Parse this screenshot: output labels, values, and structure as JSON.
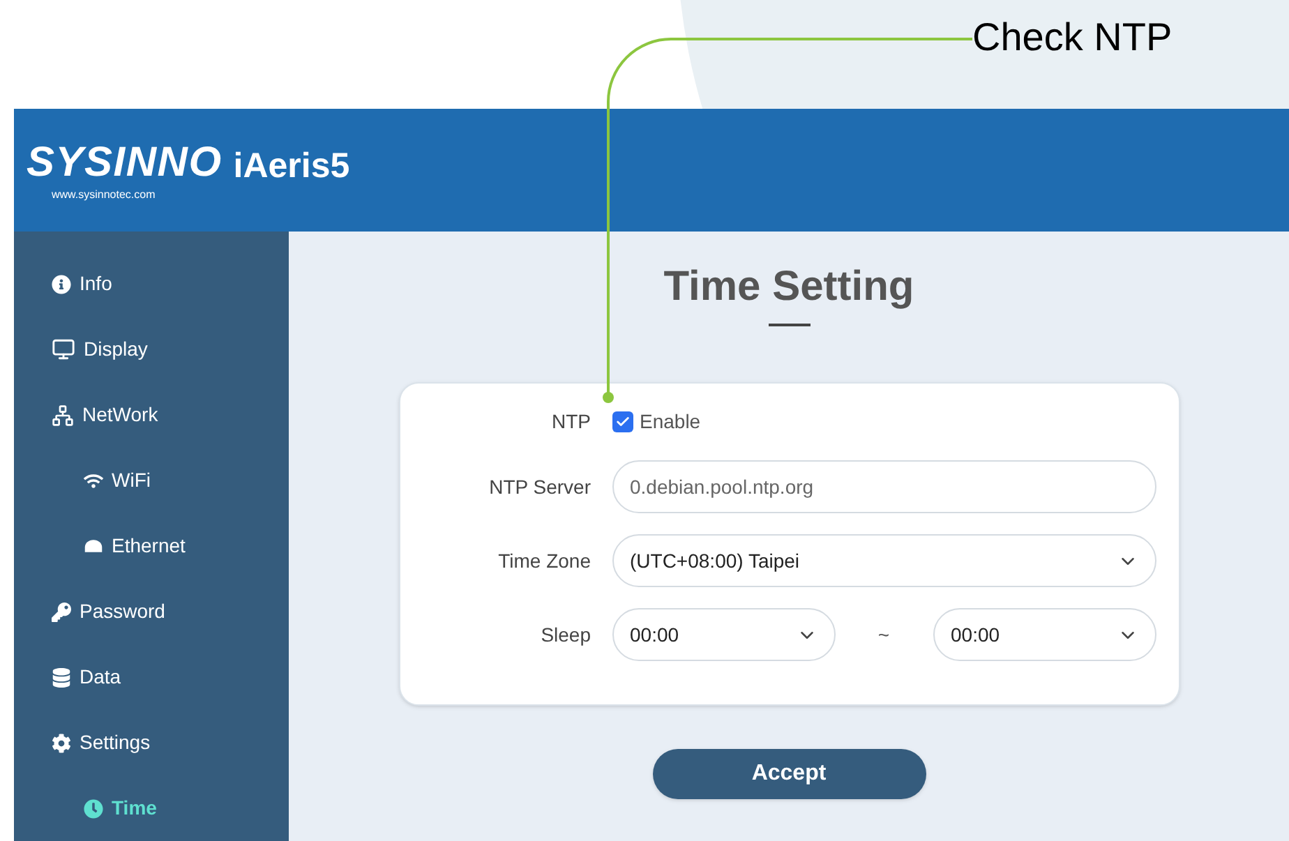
{
  "callout": {
    "text": "Check NTP"
  },
  "header": {
    "brand": "SYSINNO",
    "product": "iAeris5",
    "website": "www.sysinnotec.com"
  },
  "sidebar": {
    "items": [
      {
        "label": "Info",
        "kind": "item",
        "selected": false
      },
      {
        "label": "Display",
        "kind": "item",
        "selected": false
      },
      {
        "label": "NetWork",
        "kind": "item",
        "selected": false
      },
      {
        "label": "WiFi",
        "kind": "sub",
        "selected": false
      },
      {
        "label": "Ethernet",
        "kind": "sub",
        "selected": false
      },
      {
        "label": "Password",
        "kind": "item",
        "selected": false
      },
      {
        "label": "Data",
        "kind": "item",
        "selected": false
      },
      {
        "label": "Settings",
        "kind": "item",
        "selected": false
      },
      {
        "label": "Time",
        "kind": "sub",
        "selected": true
      }
    ]
  },
  "page": {
    "title": "Time Setting"
  },
  "form": {
    "ntp": {
      "label": "NTP",
      "option": "Enable",
      "checked": true
    },
    "server": {
      "label": "NTP Server",
      "value": "0.debian.pool.ntp.org"
    },
    "timezone": {
      "label": "Time Zone",
      "value": "(UTC+08:00) Taipei"
    },
    "sleep": {
      "label": "Sleep",
      "from": "00:00",
      "separator": "~",
      "to": "00:00"
    }
  },
  "accept_button": "Accept"
}
